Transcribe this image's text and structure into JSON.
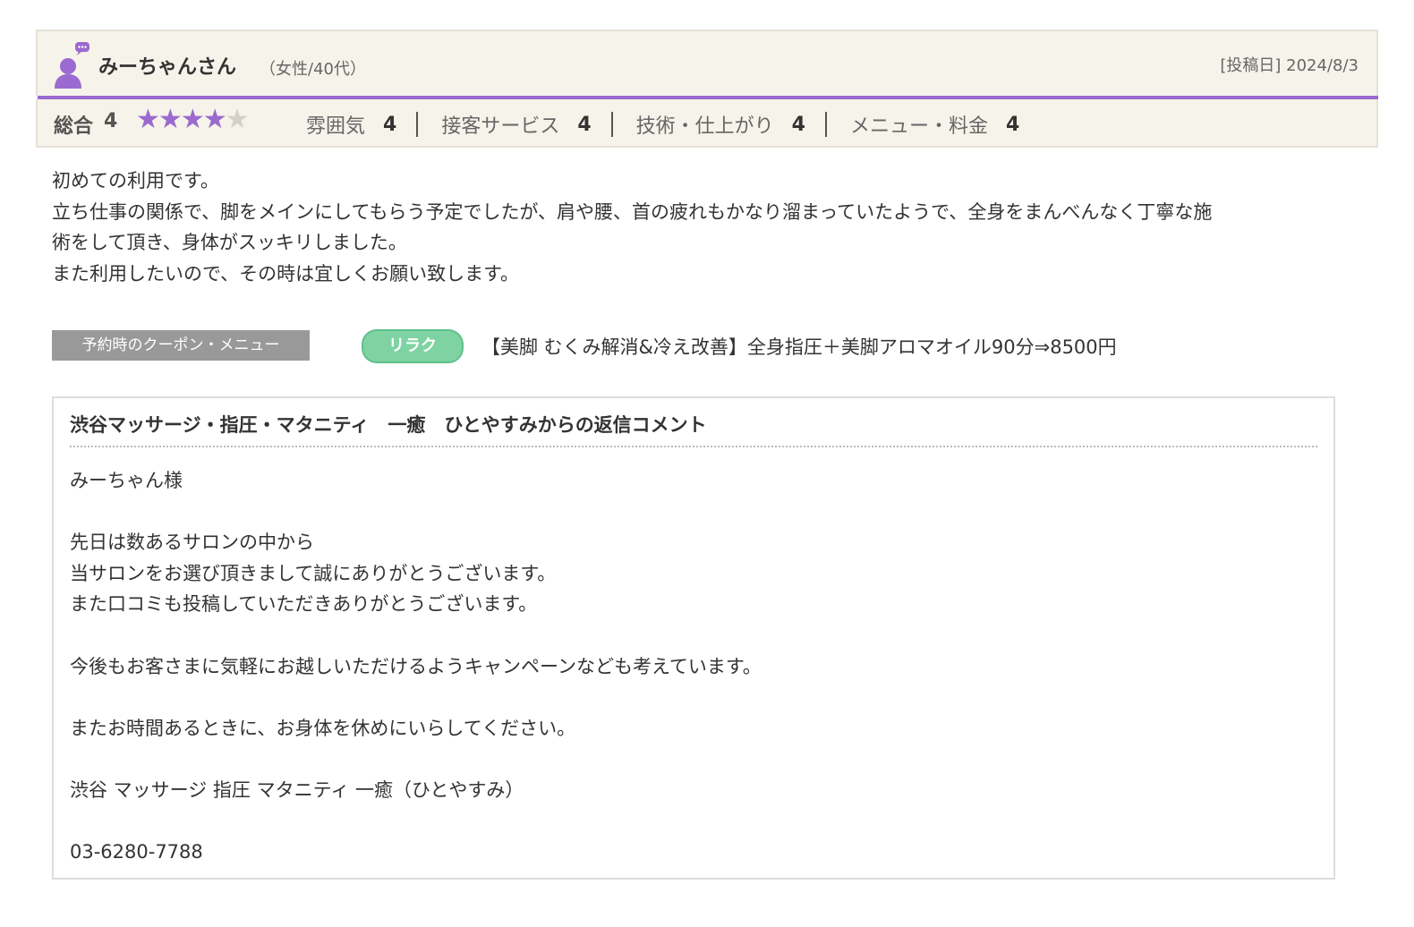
{
  "review": {
    "reviewer_name": "みーちゃんさん",
    "reviewer_meta": "（女性/40代）",
    "post_date": "[投稿日] 2024/8/3",
    "overall_label": "総合",
    "overall_value": "4",
    "stars_filled": 4,
    "stars_total": 5,
    "sub_ratings": [
      {
        "label": "雰囲気",
        "value": "4"
      },
      {
        "label": "接客サービス",
        "value": "4"
      },
      {
        "label": "技術・仕上がり",
        "value": "4"
      },
      {
        "label": "メニュー・料金",
        "value": "4"
      }
    ],
    "body_lines": [
      "初めての利用です。",
      "立ち仕事の関係で、脚をメインにしてもらう予定でしたが、肩や腰、首の疲れもかなり溜まっていたようで、全身をまんべんなく丁寧な施",
      "術をして頂き、身体がスッキリしました。",
      "また利用したいので、その時は宜しくお願い致します。"
    ]
  },
  "coupon": {
    "label": "予約時のクーポン・メニュー",
    "tag": "リラク",
    "text": "【美脚 むくみ解消&冷え改善】全身指圧＋美脚アロマオイル90分⇒8500円"
  },
  "reply": {
    "title": "渋谷マッサージ・指圧・マタニティ　一癒　ひとやすみからの返信コメント",
    "lines": [
      "みーちゃん様",
      "",
      "先日は数あるサロンの中から",
      "当サロンをお選び頂きまして誠にありがとうございます。",
      "また口コミも投稿していただきありがとうございます。",
      "",
      "今後もお客さまに気軽にお越しいただけるようキャンペーンなども考えています。",
      "",
      "またお時間あるときに、お身体を休めにいらしてください。",
      "",
      "渋谷 マッサージ 指圧 マタニティ 一癒（ひとやすみ）",
      "",
      "03-6280-7788"
    ]
  },
  "colors": {
    "accent_purple": "#9b6ad0",
    "header_bg": "#f6f3ea",
    "coupon_tag_green": "#7fd3a3",
    "coupon_label_gray": "#999999"
  },
  "icons": {
    "avatar": "user-chat-icon",
    "star": "star-icon"
  }
}
